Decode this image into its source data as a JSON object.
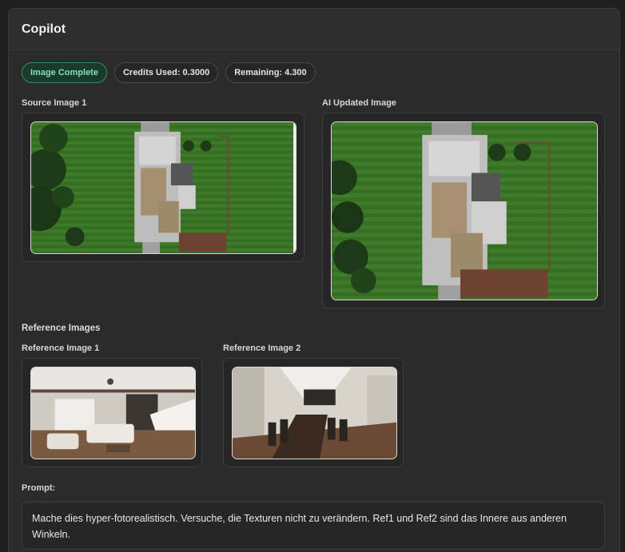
{
  "panel": {
    "title": "Copilot"
  },
  "badges": {
    "status": "Image Complete",
    "credits_used": "Credits Used: 0.3000",
    "remaining": "Remaining: 4.300"
  },
  "source": {
    "label": "Source Image 1"
  },
  "ai": {
    "label": "AI Updated Image"
  },
  "reference": {
    "section_label": "Reference Images",
    "items": [
      {
        "label": "Reference Image 1"
      },
      {
        "label": "Reference Image 2"
      }
    ]
  },
  "prompt": {
    "label": "Prompt:",
    "text": "Mache dies hyper-fotorealistisch. Versuche, die Texturen nicht zu verändern. Ref1 und Ref2 sind das Innere aus anderen Winkeln."
  },
  "colors": {
    "success_green": "#7fe0b4",
    "panel_bg": "#2b2b2b",
    "grass": "#3f7a2a"
  }
}
